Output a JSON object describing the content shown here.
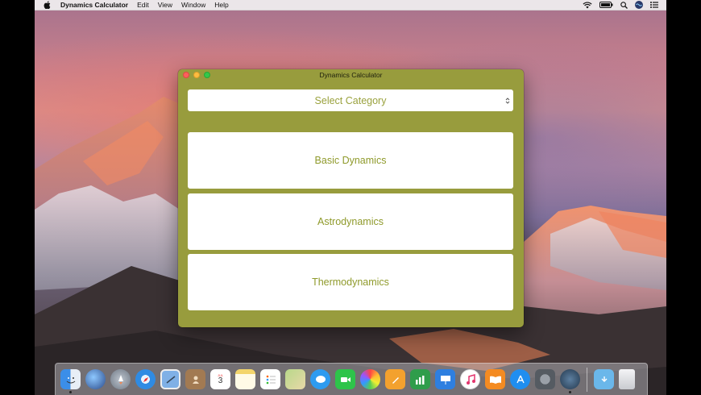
{
  "menubar": {
    "app_name": "Dynamics Calculator",
    "menus": [
      "Edit",
      "View",
      "Window",
      "Help"
    ],
    "status_icons": [
      "wifi-icon",
      "battery-icon",
      "spotlight-icon",
      "siri-icon",
      "notification-center-icon"
    ]
  },
  "window": {
    "title": "Dynamics Calculator",
    "select_placeholder": "Select Category",
    "categories": [
      "Basic Dynamics",
      "Astrodynamics",
      "Thermodynamics"
    ]
  },
  "dock": {
    "calendar_day": "3",
    "calendar_month": "JUL"
  },
  "colors": {
    "window_bg": "#989c3d",
    "text_accent": "#8f9a2b"
  }
}
